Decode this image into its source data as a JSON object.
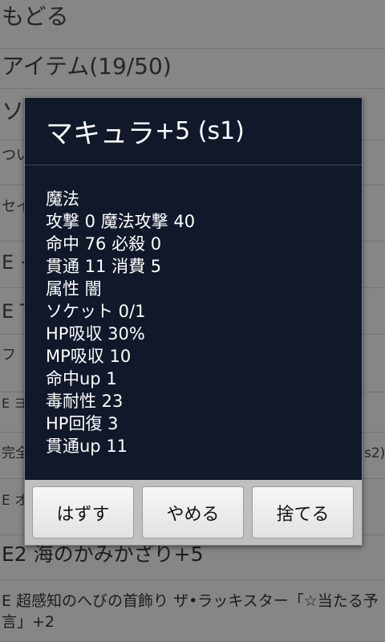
{
  "background_list": {
    "back_label": "もどる",
    "section_title": "アイテム(19/50)",
    "rows": [
      "ソ",
      "つい",
      "セイ",
      "E イ",
      "E T",
      "フ",
      "E ヨ",
      "完全",
      "E オ",
      "E2 海のかみかざり+5",
      "E 超感知のへびの首飾り ザ•ラッキスター「☆当たる予言」+2"
    ],
    "row_fragment_right": "s2)"
  },
  "dialog": {
    "title_name": "マキュラ",
    "title_suffix": "+5 (s1)",
    "stats": [
      "魔法",
      "攻撃 0 魔法攻撃 40",
      "命中 76 必殺 0",
      "貫通 11 消費 5",
      "属性 闇",
      "ソケット 0/1",
      "HP吸収 30%",
      "MP吸収 10",
      "命中up 1",
      "毒耐性 23",
      "HP回復 3",
      "貫通up 11"
    ],
    "buttons": {
      "unequip": "はずす",
      "cancel": "やめる",
      "discard": "捨てる"
    }
  }
}
